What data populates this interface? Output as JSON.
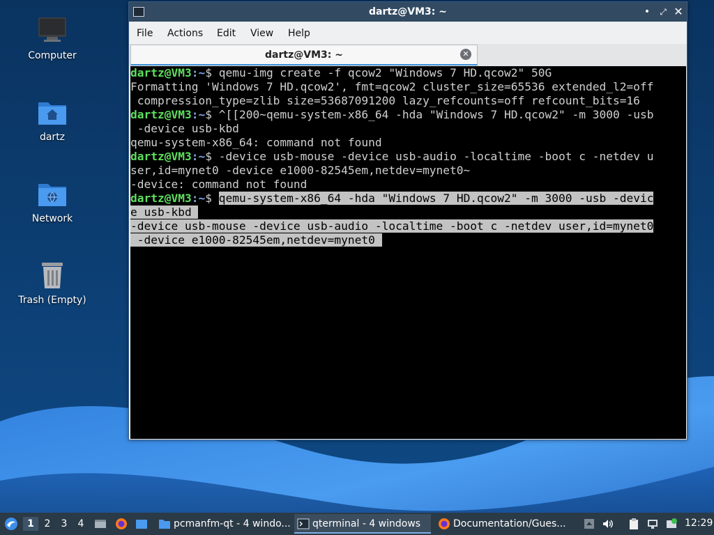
{
  "colors": {
    "wallpaper_dark": "#0b3766",
    "wave_light": "#3f8ee8",
    "terminal_bg": "#000000",
    "prompt_user": "#5ee05e",
    "prompt_path": "#7aa7e8",
    "selection_bg": "#c3c3c3",
    "titlebar_bg": "#324a62",
    "taskbar_bg": "#2b3a47"
  },
  "desktop": {
    "icons": [
      {
        "label": "Computer",
        "icon": "computer-icon"
      },
      {
        "label": "dartz",
        "icon": "home-folder-icon"
      },
      {
        "label": "Network",
        "icon": "network-folder-icon"
      },
      {
        "label": "Trash (Empty)",
        "icon": "trash-icon"
      }
    ]
  },
  "window": {
    "title": "dartz@VM3: ~",
    "menu": [
      "File",
      "Actions",
      "Edit",
      "View",
      "Help"
    ],
    "tab_label": "dartz@VM3: ~"
  },
  "terminal": {
    "prompt_user": "dartz@VM3",
    "prompt_path": ":~",
    "prompt_symbol": "$ ",
    "lines": [
      {
        "p": true,
        "cmd": "qemu-img create -f qcow2 \"Windows 7 HD.qcow2\" 50G"
      },
      {
        "text": "Formatting 'Windows 7 HD.qcow2', fmt=qcow2 cluster_size=65536 extended_l2=off"
      },
      {
        "text": " compression_type=zlib size=53687091200 lazy_refcounts=off refcount_bits=16"
      },
      {
        "p": true,
        "cmd": "^[[200~qemu-system-x86_64 -hda \"Windows 7 HD.qcow2\" -m 3000 -usb"
      },
      {
        "text": " -device usb-kbd"
      },
      {
        "text": "qemu-system-x86_64: command not found"
      },
      {
        "p": true,
        "cmd": "-device usb-mouse -device usb-audio -localtime -boot c -netdev u"
      },
      {
        "text": "ser,id=mynet0 -device e1000-82545em,netdev=mynet0~"
      },
      {
        "text": "-device: command not found"
      },
      {
        "p": true,
        "cmd": "qemu-system-x86_64 -hda \"Windows 7 HD.qcow2\" -m 3000 -usb -devic",
        "sel": true
      },
      {
        "text": "e usb-kbd ",
        "sel": true
      },
      {
        "text": "-device usb-mouse -device usb-audio -localtime -boot c -netdev user,id=mynet0",
        "sel": true
      },
      {
        "text": " -device e1000-82545em,netdev=mynet0 ",
        "sel": true
      }
    ]
  },
  "taskbar": {
    "workspaces": [
      "1",
      "2",
      "3",
      "4"
    ],
    "active_workspace": "1",
    "tasks": [
      {
        "label": "pcmanfm-qt - 4 windo...",
        "icon": "folder-icon"
      },
      {
        "label": "qterminal - 4 windows",
        "icon": "terminal-icon",
        "active": true
      },
      {
        "label": "Documentation/Gues...",
        "icon": "firefox-icon"
      }
    ],
    "clock": "12:29"
  }
}
